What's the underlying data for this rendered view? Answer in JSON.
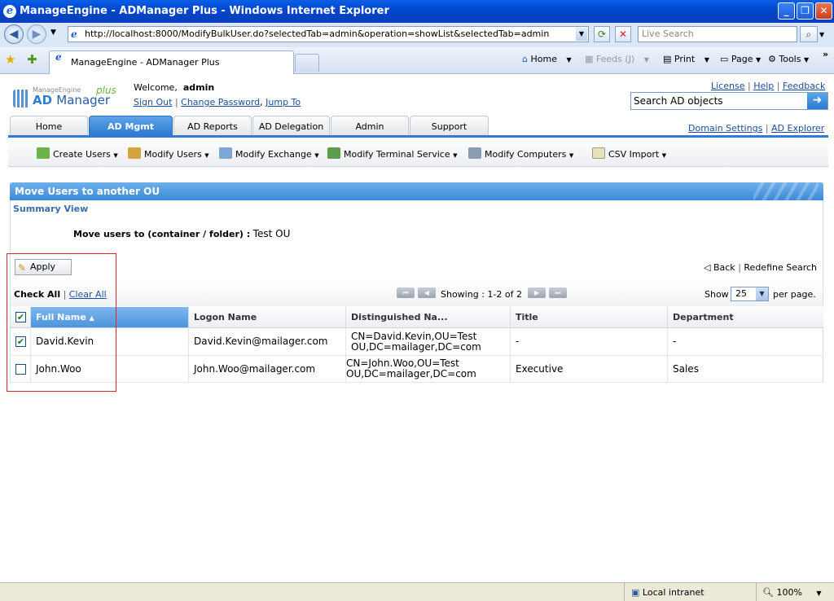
{
  "window": {
    "title": "ManageEngine - ADManager Plus - Windows Internet Explorer"
  },
  "browser": {
    "url": "http://localhost:8000/ModifyBulkUser.do?selectedTab=admin&operation=showList&selectedTab=admin",
    "search_placeholder": "Live Search",
    "tab_label": "ManageEngine - ADManager Plus",
    "commands": {
      "home": "Home",
      "feeds": "Feeds (J)",
      "print": "Print",
      "page": "Page",
      "tools": "Tools"
    }
  },
  "header": {
    "logo_small": "ManageEngine",
    "logo_ad": "AD",
    "logo_main": "Manager",
    "logo_plus": "plus",
    "welcome": "Welcome,",
    "user": "admin",
    "sign_out": "Sign Out",
    "change_password": "Change Password",
    "jump_to": "Jump To",
    "license": "License",
    "help": "Help",
    "feedback": "Feedback",
    "search_placeholder": "Search AD objects",
    "domain_settings": "Domain Settings",
    "ad_explorer": "AD Explorer"
  },
  "tabs": [
    "Home",
    "AD Mgmt",
    "AD Reports",
    "AD Delegation",
    "Admin",
    "Support"
  ],
  "submenu": [
    "Create Users",
    "Modify Users",
    "Modify Exchange",
    "Modify Terminal Service",
    "Modify Computers",
    "CSV Import"
  ],
  "panel": {
    "title": "Move Users to another OU",
    "summary": "Summary View",
    "move_label": "Move users to (container / folder) :",
    "move_value": "Test OU",
    "apply": "Apply",
    "back": "Back",
    "redefine": "Redefine Search",
    "check_all": "Check All",
    "clear_all": "Clear All",
    "showing": "Showing : 1-2 of 2",
    "show": "Show",
    "per_page_value": "25",
    "per_page": "per page."
  },
  "table": {
    "columns": [
      "Full Name",
      "Logon Name",
      "Distinguished Na...",
      "Title",
      "Department"
    ],
    "rows": [
      {
        "checked": true,
        "name": "David.Kevin",
        "logon": "David.Kevin@mailager.com",
        "dn1": "CN=David.Kevin,OU=Test",
        "dn2": "OU,DC=mailager,DC=com",
        "title": "-",
        "dept": "-"
      },
      {
        "checked": false,
        "name": "John.Woo",
        "logon": "John.Woo@mailager.com",
        "dn1": "CN=John.Woo,OU=Test",
        "dn2": "OU,DC=mailager,DC=com",
        "title": "Executive",
        "dept": "Sales"
      }
    ]
  },
  "status": {
    "zone": "Local intranet",
    "zoom": "100%"
  }
}
